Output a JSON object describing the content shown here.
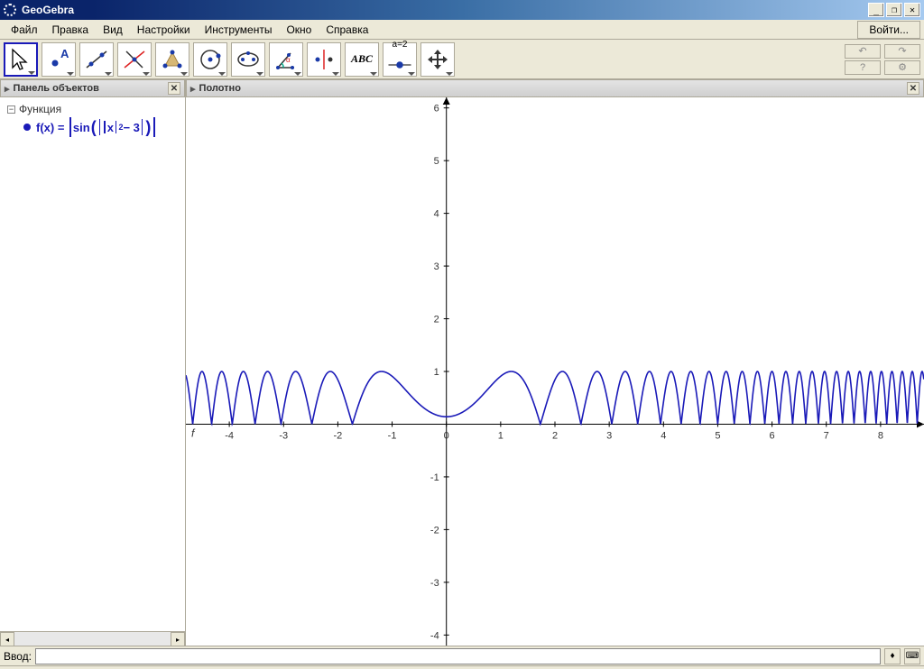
{
  "window": {
    "title": "GeoGebra"
  },
  "menubar": {
    "items": [
      "Файл",
      "Правка",
      "Вид",
      "Настройки",
      "Инструменты",
      "Окно",
      "Справка"
    ],
    "login": "Войти..."
  },
  "toolbar": {
    "tools": [
      {
        "name": "move-tool",
        "selected": true
      },
      {
        "name": "point-tool"
      },
      {
        "name": "line-tool"
      },
      {
        "name": "perpendicular-tool"
      },
      {
        "name": "polygon-tool"
      },
      {
        "name": "circle-tool"
      },
      {
        "name": "ellipse-tool"
      },
      {
        "name": "angle-tool"
      },
      {
        "name": "reflect-tool"
      },
      {
        "name": "text-tool",
        "label": "ABC"
      },
      {
        "name": "slider-tool",
        "label": "a=2"
      },
      {
        "name": "move-view-tool"
      }
    ]
  },
  "panels": {
    "objects_title": "Панель объектов",
    "canvas_title": "Полотно",
    "category": "Функция",
    "func_label": "f(x)  =",
    "func_body_sin": "sin",
    "func_body_abs_inner": "x",
    "func_body_power": "2",
    "func_body_minus3": " − 3",
    "func_letter": "f"
  },
  "inputbar": {
    "label": "Ввод:",
    "value": ""
  },
  "chart_data": {
    "type": "line",
    "title": "",
    "xlabel": "",
    "ylabel": "",
    "x_range": [
      -4.8,
      8.8
    ],
    "y_range": [
      -4.2,
      6.2
    ],
    "x_ticks": [
      -4,
      -3,
      -2,
      -1,
      0,
      1,
      2,
      3,
      4,
      5,
      6,
      7,
      8
    ],
    "y_ticks": [
      -4,
      -3,
      -2,
      -1,
      1,
      2,
      3,
      4,
      5,
      6
    ],
    "formula": "|sin(||x|^2 - 3|)|",
    "series": [
      {
        "name": "f",
        "color": "#1a1ab8",
        "definition": "abs(sin(abs(abs(x)^2 - 3)))"
      }
    ]
  }
}
